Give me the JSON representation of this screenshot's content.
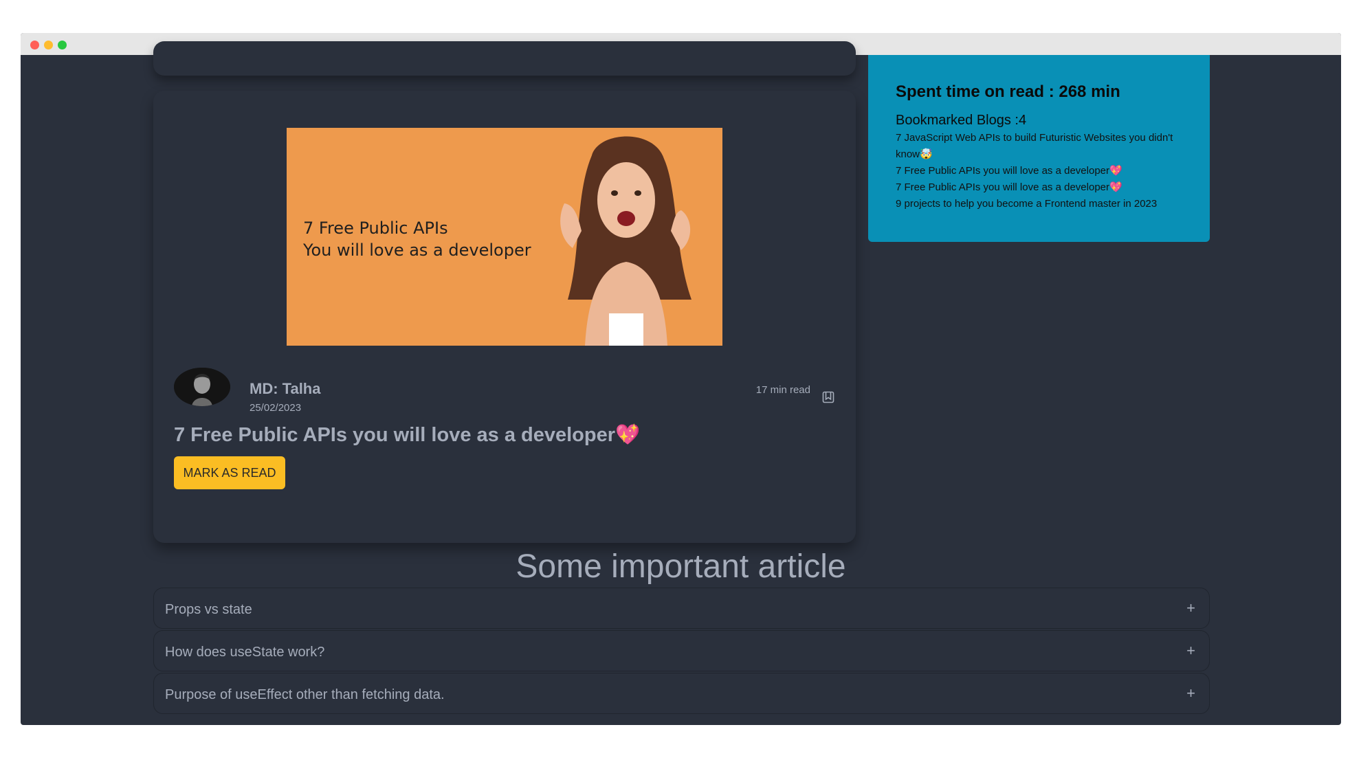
{
  "blog": {
    "cover_line1": "7 Free Public APIs",
    "cover_line2": "You will love as a developer",
    "author": "MD: Talha",
    "date": "25/02/2023",
    "read_time": "17 min read",
    "title": "7 Free Public APIs you will love as a developer💖",
    "mark_as_read_label": "MARK AS READ"
  },
  "sidebar": {
    "spent_time": "Spent time on read : 268 min",
    "bookmarked_heading": "Bookmarked Blogs :4",
    "bookmarks": [
      "7 JavaScript Web APIs to build Futuristic Websites you didn't know🤯",
      "7 Free Public APIs you will love as a developer💖",
      "7 Free Public APIs you will love as a developer💖",
      "9 projects to help you become a Frontend master in 2023"
    ]
  },
  "faq": {
    "heading": "Some important article",
    "items": [
      {
        "question": "Props vs state",
        "toggle": "+"
      },
      {
        "question": "How does useState work?",
        "toggle": "+"
      },
      {
        "question": "Purpose of useEffect other than fetching data.",
        "toggle": "+"
      }
    ]
  },
  "colors": {
    "background": "#2a303c",
    "sidebar": "#0990b6",
    "button": "#fbbd23",
    "cover": "#ee9a4d"
  }
}
